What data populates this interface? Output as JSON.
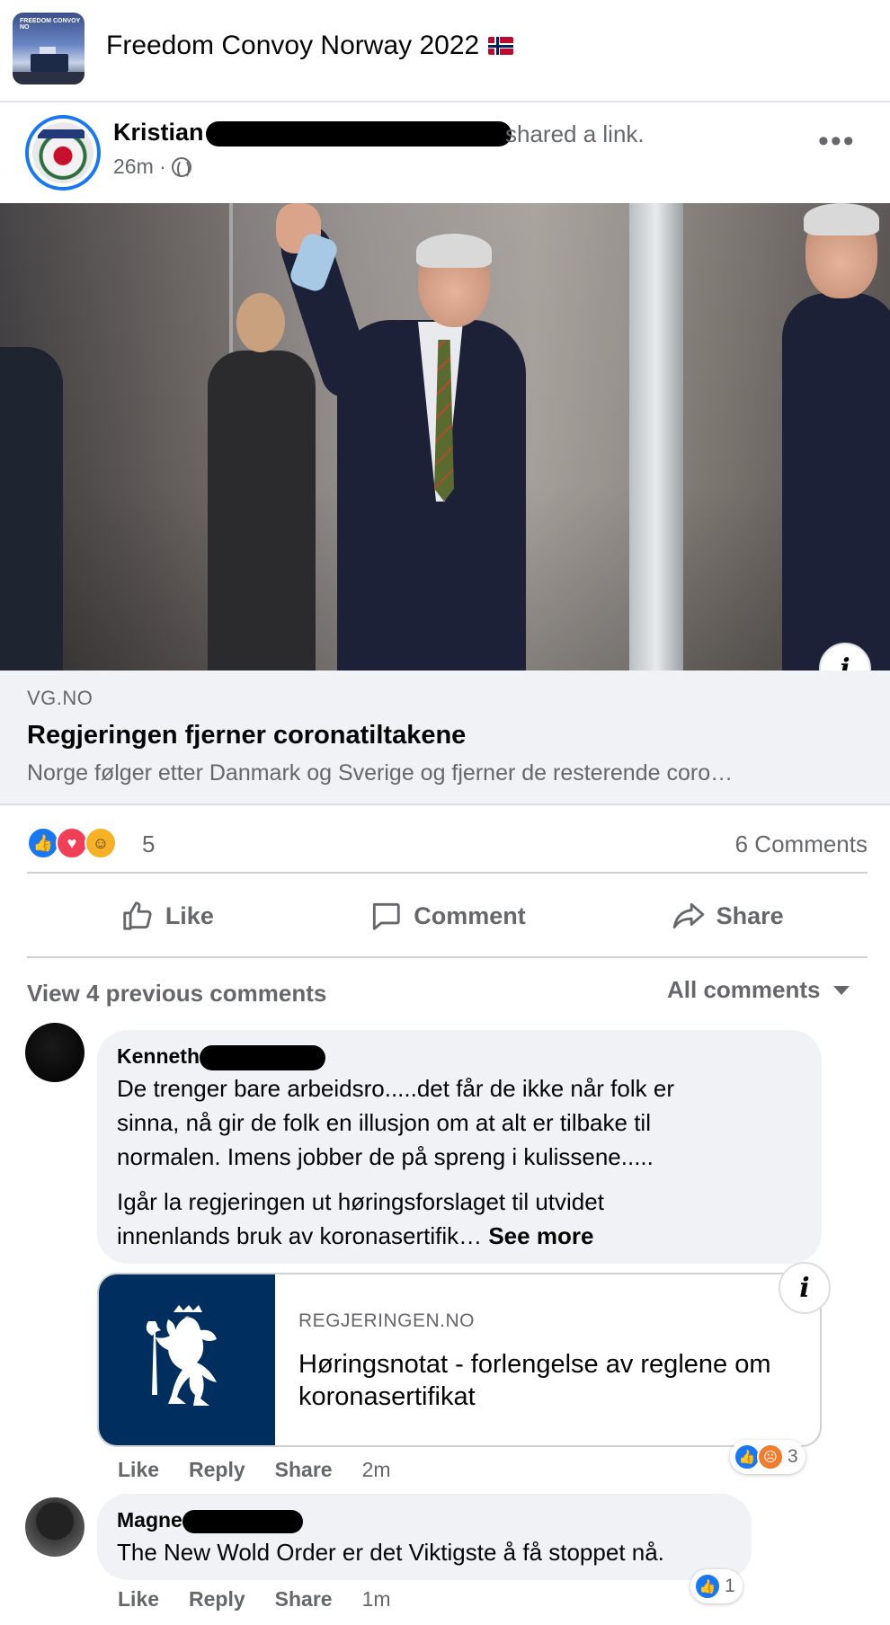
{
  "group": {
    "name": "Freedom Convoy Norway 2022",
    "thumb_text": "FREEDOM CONVOY NO"
  },
  "post": {
    "author": "Kristian",
    "action": "shared a link.",
    "time": "26m ·",
    "privacy_icon": "globe-icon",
    "more_label": "•••"
  },
  "link": {
    "domain": "VG.NO",
    "title": "Regjeringen fjerner coronatiltakene",
    "description": "Norge følger etter Danmark og Sverige og fjerner de resterende coro…",
    "info_label": "i"
  },
  "stats": {
    "reaction_count": "5",
    "comments_count": "6 Comments",
    "reactions": [
      "like",
      "love",
      "haha"
    ]
  },
  "actions": {
    "like": "Like",
    "comment": "Comment",
    "share": "Share"
  },
  "comments_section": {
    "view_previous": "View 4 previous comments",
    "filter": "All comments"
  },
  "comments": [
    {
      "name": "Kenneth",
      "paragraph1_lines": [
        "De trenger bare arbeidsro.....det får de ikke når folk er",
        "sinna, nå gir de folk en illusjon om at alt er tilbake til",
        "normalen. Imens jobber de på spreng i kulissene....."
      ],
      "paragraph2_lines": [
        "Igår la regjeringen ut høringsforslaget til utvidet",
        "innenlands bruk av koronasertifik…"
      ],
      "see_more": "See more",
      "link": {
        "domain": "REGJERINGEN.NO",
        "title": "Høringsnotat - forlengelse av reglene om koronasertifikat",
        "info_label": "i"
      },
      "like": "Like",
      "reply": "Reply",
      "share": "Share",
      "time": "2m",
      "reaction_count": "3"
    },
    {
      "name": "Magne",
      "text": "The New Wold Order er det Viktigste å få stoppet nå.",
      "like": "Like",
      "reply": "Reply",
      "share": "Share",
      "time": "1m",
      "reaction_count": "1"
    }
  ],
  "colors": {
    "accent": "#1877f2",
    "muted_text": "#65676b",
    "bubble": "#f0f2f5",
    "gov_blue": "#002f5f"
  }
}
